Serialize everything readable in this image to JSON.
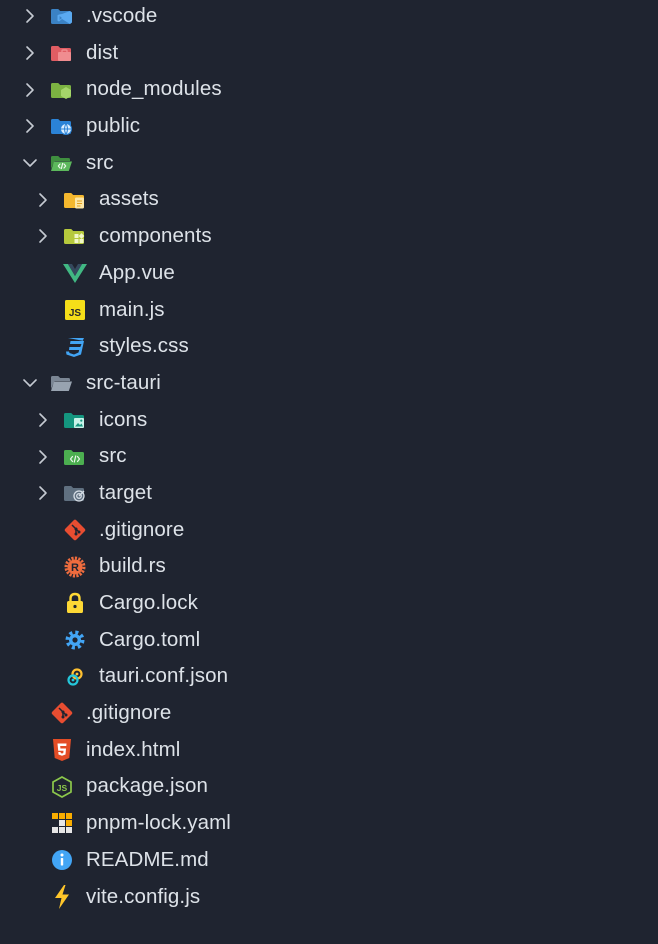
{
  "explorer": {
    "items": [
      {
        "label": ".vscode",
        "depth": 0,
        "kind": "folder",
        "expanded": false,
        "icon": "vscode-folder-icon"
      },
      {
        "label": "dist",
        "depth": 0,
        "kind": "folder",
        "expanded": false,
        "icon": "dist-folder-icon"
      },
      {
        "label": "node_modules",
        "depth": 0,
        "kind": "folder",
        "expanded": false,
        "icon": "node-folder-icon"
      },
      {
        "label": "public",
        "depth": 0,
        "kind": "folder",
        "expanded": false,
        "icon": "public-folder-icon"
      },
      {
        "label": "src",
        "depth": 0,
        "kind": "folder",
        "expanded": true,
        "icon": "src-folder-open-icon"
      },
      {
        "label": "assets",
        "depth": 1,
        "kind": "folder",
        "expanded": false,
        "icon": "assets-folder-icon"
      },
      {
        "label": "components",
        "depth": 1,
        "kind": "folder",
        "expanded": false,
        "icon": "components-folder-icon"
      },
      {
        "label": "App.vue",
        "depth": 1,
        "kind": "file",
        "icon": "vue-file-icon"
      },
      {
        "label": "main.js",
        "depth": 1,
        "kind": "file",
        "icon": "javascript-file-icon"
      },
      {
        "label": "styles.css",
        "depth": 1,
        "kind": "file",
        "icon": "css-file-icon"
      },
      {
        "label": "src-tauri",
        "depth": 0,
        "kind": "folder",
        "expanded": true,
        "icon": "folder-open-icon"
      },
      {
        "label": "icons",
        "depth": 1,
        "kind": "folder",
        "expanded": false,
        "icon": "images-folder-icon"
      },
      {
        "label": "src",
        "depth": 1,
        "kind": "folder",
        "expanded": false,
        "icon": "src-folder-icon"
      },
      {
        "label": "target",
        "depth": 1,
        "kind": "folder",
        "expanded": false,
        "icon": "target-folder-icon"
      },
      {
        "label": ".gitignore",
        "depth": 1,
        "kind": "file",
        "icon": "git-file-icon"
      },
      {
        "label": "build.rs",
        "depth": 1,
        "kind": "file",
        "icon": "rust-file-icon"
      },
      {
        "label": "Cargo.lock",
        "depth": 1,
        "kind": "file",
        "icon": "lock-file-icon"
      },
      {
        "label": "Cargo.toml",
        "depth": 1,
        "kind": "file",
        "icon": "settings-file-icon"
      },
      {
        "label": "tauri.conf.json",
        "depth": 1,
        "kind": "file",
        "icon": "tauri-file-icon"
      },
      {
        "label": ".gitignore",
        "depth": 0,
        "kind": "file",
        "icon": "git-file-icon"
      },
      {
        "label": "index.html",
        "depth": 0,
        "kind": "file",
        "icon": "html-file-icon"
      },
      {
        "label": "package.json",
        "depth": 0,
        "kind": "file",
        "icon": "nodejs-file-icon"
      },
      {
        "label": "pnpm-lock.yaml",
        "depth": 0,
        "kind": "file",
        "icon": "pnpm-file-icon"
      },
      {
        "label": "README.md",
        "depth": 0,
        "kind": "file",
        "icon": "info-file-icon"
      },
      {
        "label": "vite.config.js",
        "depth": 0,
        "kind": "file",
        "icon": "vite-file-icon"
      }
    ]
  }
}
